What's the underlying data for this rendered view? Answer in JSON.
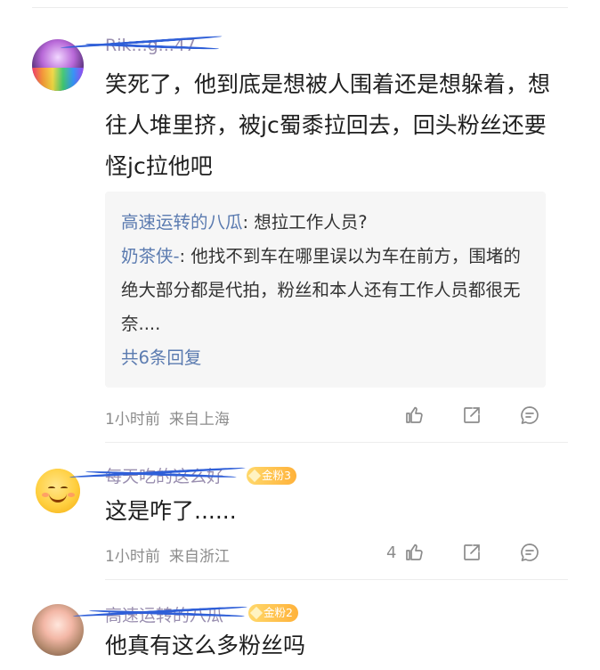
{
  "comments": [
    {
      "username": "Rik...g...47",
      "text": "笑死了，他到底是想被人围着还是想躲着，想往人堆里挤，被jc蜀黍拉回去，回头粉丝还要怪jc拉他吧",
      "time": "1小时前",
      "location": "来自上海",
      "replies": [
        {
          "name": "高速运转的八瓜",
          "text": ": 想拉工作人员?"
        },
        {
          "name": "奶茶侠-",
          "text": ": 他找不到车在哪里误以为车在前方，围堵的绝大部分都是代拍，粉丝和本人还有工作人员都很无奈...."
        }
      ],
      "more_replies": "共6条回复"
    },
    {
      "username": "每天吃的这么好",
      "badge": "金粉3",
      "text": "这是咋了......",
      "time": "1小时前",
      "location": "来自浙江",
      "likes": "4"
    },
    {
      "username": "高速运转的八瓜",
      "badge": "金粉2",
      "text": "他真有这么多粉丝吗"
    }
  ],
  "colors": {
    "link": "#5b7bb0",
    "scribble": "#2f5fd8",
    "badge": "#ffb23a"
  },
  "icons": [
    "like-icon",
    "share-icon",
    "comment-icon"
  ]
}
